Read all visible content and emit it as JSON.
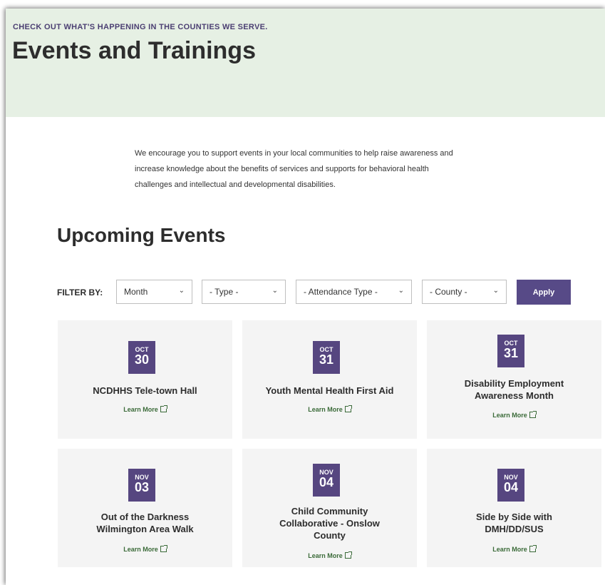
{
  "hero": {
    "eyebrow": "CHECK OUT WHAT'S HAPPENING IN THE COUNTIES WE SERVE.",
    "title": "Events and Trainings",
    "background": "#e6f0e4"
  },
  "intro": {
    "lines": [
      "We encourage you to support events in your local communities to help raise awareness and",
      "increase knowledge about the benefits of services and supports for behavioral health",
      "challenges and intellectual and developmental disabilities."
    ]
  },
  "section_title": "Upcoming Events",
  "filters": {
    "label": "FILTER BY:",
    "selects": [
      {
        "value": "Month"
      },
      {
        "value": "- Type -"
      },
      {
        "value": "- Attendance Type -"
      },
      {
        "value": "- County -"
      }
    ],
    "apply_label": "Apply",
    "accent": "#574a87"
  },
  "events": [
    {
      "month": "OCT",
      "day": "30",
      "title_lines": [
        "NCDHHS Tele-town Hall"
      ],
      "link": "Learn More"
    },
    {
      "month": "OCT",
      "day": "31",
      "title_lines": [
        "Youth Mental Health First Aid"
      ],
      "link": "Learn More"
    },
    {
      "month": "OCT",
      "day": "31",
      "title_lines": [
        "Disability Employment",
        "Awareness Month"
      ],
      "link": "Learn More"
    },
    {
      "month": "NOV",
      "day": "03",
      "title_lines": [
        "Out of the Darkness",
        "Wilmington Area Walk"
      ],
      "link": "Learn More"
    },
    {
      "month": "NOV",
      "day": "04",
      "title_lines": [
        "Child Community",
        "Collaborative - Onslow",
        "County"
      ],
      "link": "Learn More"
    },
    {
      "month": "NOV",
      "day": "04",
      "title_lines": [
        "Side by Side with",
        "DMH/DD/SUS"
      ],
      "link": "Learn More"
    }
  ]
}
